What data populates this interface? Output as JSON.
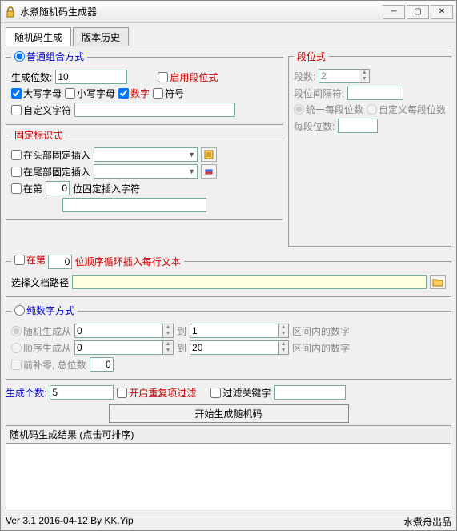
{
  "window": {
    "title": "水煮随机码生成器"
  },
  "tabs": {
    "t1": "随机码生成",
    "t2": "版本历史"
  },
  "common": {
    "legend": "普通组合方式",
    "genDigitsLabel": "生成位数:",
    "genDigitsValue": "10",
    "enableSeg": "启用段位式",
    "upper": "大写字母",
    "lower": "小写字母",
    "number": "数字",
    "symbol": "符号",
    "custom": "自定义字符"
  },
  "seg": {
    "legend": "段位式",
    "segCountLabel": "段数:",
    "segCountValue": "2",
    "sepLabel": "段位间隔符:",
    "sepValue": "",
    "unified": "统一每段位数",
    "customEach": "自定义每段位数",
    "eachLabel": "每段位数:",
    "eachValue": ""
  },
  "fixed": {
    "legend": "固定标识式",
    "head": "在头部固定插入",
    "tail": "在尾部固定插入",
    "atPrefix": "在第",
    "atPos": "0",
    "atSuffix": "位固定插入字符"
  },
  "loop": {
    "atPrefix": "在第",
    "atPos": "0",
    "suffix": "位顺序循环插入每行文本",
    "pathLabel": "选择文档路径"
  },
  "numeric": {
    "legend": "纯数字方式",
    "randFrom": "随机生成从",
    "randA": "0",
    "to": "到",
    "randB": "1",
    "rangeSuffix": "区间内的数字",
    "seqFrom": "顺序生成从",
    "seqA": "0",
    "seqB": "20",
    "pad": "前补零, 总位数",
    "padVal": "0"
  },
  "gen": {
    "countLabel": "生成个数:",
    "countValue": "5",
    "dedup": "开启重复项过滤",
    "filterKw": "过滤关键字",
    "startBtn": "开始生成随机码"
  },
  "results": {
    "header": "随机码生成结果 (点击可排序)"
  },
  "status": {
    "left": "Ver 3.1 2016-04-12 By KK.Yip",
    "right": "水煮舟出品"
  }
}
